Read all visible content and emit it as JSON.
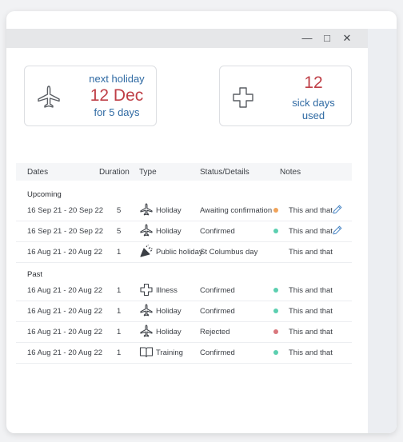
{
  "window_controls": {
    "minimize": "—",
    "maximize": "□",
    "close": "✕"
  },
  "next_holiday_card": {
    "label": "next holiday",
    "date": "12 Dec",
    "duration": "for 5 days",
    "icon": "plane-icon"
  },
  "sick_days_card": {
    "count": "12",
    "label_line1": "sick days",
    "label_line2": "used",
    "icon": "medical-cross-icon"
  },
  "table": {
    "headers": {
      "dates": "Dates",
      "duration": "Duration",
      "type": "Type",
      "status": "Status/Details",
      "notes": "Notes"
    },
    "sections": {
      "upcoming": "Upcoming",
      "past": "Past"
    },
    "upcoming_rows": [
      {
        "dates": "16 Sep 21 - 20 Sep 22",
        "duration": "5",
        "type": "Holiday",
        "type_icon": "plane-icon",
        "status": "Awaiting confirmation",
        "status_color": "#f0a35a",
        "notes": "This and that",
        "editable": true
      },
      {
        "dates": "16 Sep 21 - 20 Sep 22",
        "duration": "5",
        "type": "Holiday",
        "type_icon": "plane-icon",
        "status": "Confirmed",
        "status_color": "#5ccfb0",
        "notes": "This and that",
        "editable": true
      },
      {
        "dates": "16 Aug 21 - 20 Aug 22",
        "duration": "1",
        "type": "Public holiday",
        "type_icon": "party-popper-icon",
        "status": "St Columbus day",
        "status_color": "",
        "notes": "This and that",
        "editable": false
      }
    ],
    "past_rows": [
      {
        "dates": "16 Aug 21 - 20 Aug 22",
        "duration": "1",
        "type": "Illness",
        "type_icon": "medical-cross-icon",
        "status": "Confirmed",
        "status_color": "#5ccfb0",
        "notes": "This and that"
      },
      {
        "dates": "16 Aug 21 - 20 Aug 22",
        "duration": "1",
        "type": "Holiday",
        "type_icon": "plane-icon",
        "status": "Confirmed",
        "status_color": "#5ccfb0",
        "notes": "This and that"
      },
      {
        "dates": "16 Aug 21 - 20 Aug 22",
        "duration": "1",
        "type": "Holiday",
        "type_icon": "plane-icon",
        "status": "Rejected",
        "status_color": "#d9777d",
        "notes": "This and that"
      },
      {
        "dates": "16 Aug 21 - 20 Aug 22",
        "duration": "1",
        "type": "Training",
        "type_icon": "book-icon",
        "status": "Confirmed",
        "status_color": "#5ccfb0",
        "notes": "This and that"
      }
    ]
  },
  "colors": {
    "accent_blue": "#2f6aa3",
    "accent_red": "#bf3f47",
    "pending": "#f0a35a",
    "confirmed": "#5ccfb0",
    "rejected": "#d9777d"
  }
}
